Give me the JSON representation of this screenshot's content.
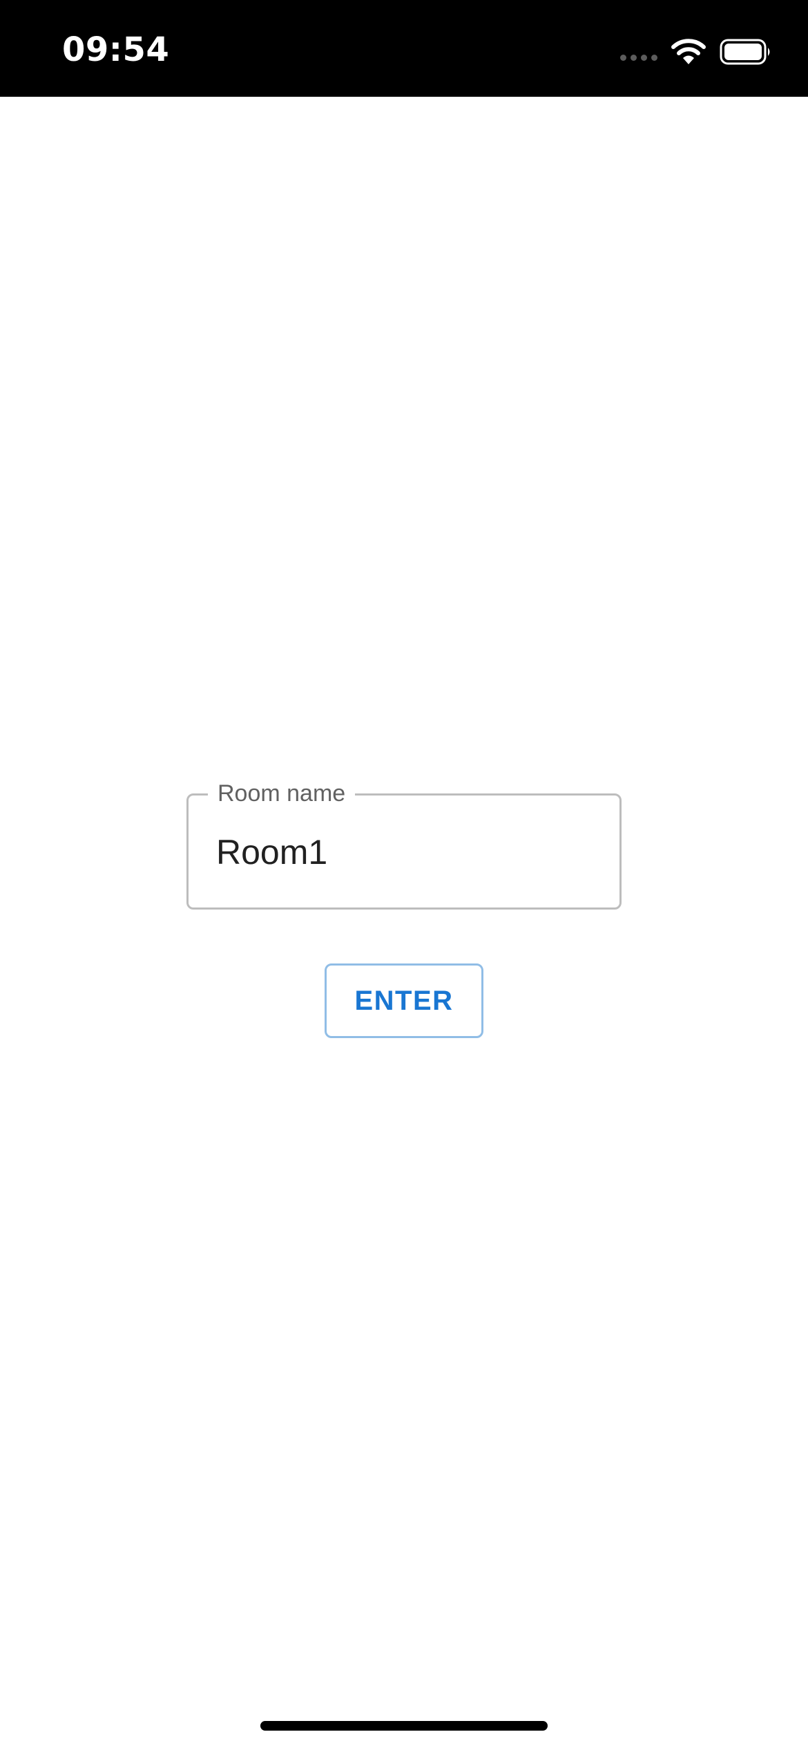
{
  "status_bar": {
    "time": "09:54",
    "icons": [
      "cellular-signal-icon",
      "wifi-icon",
      "battery-icon"
    ],
    "background_color": "#000000"
  },
  "form": {
    "room_field": {
      "label": "Room name",
      "value": "Room1"
    },
    "enter_button": {
      "label": "ENTER",
      "color": "#1976d2"
    }
  }
}
